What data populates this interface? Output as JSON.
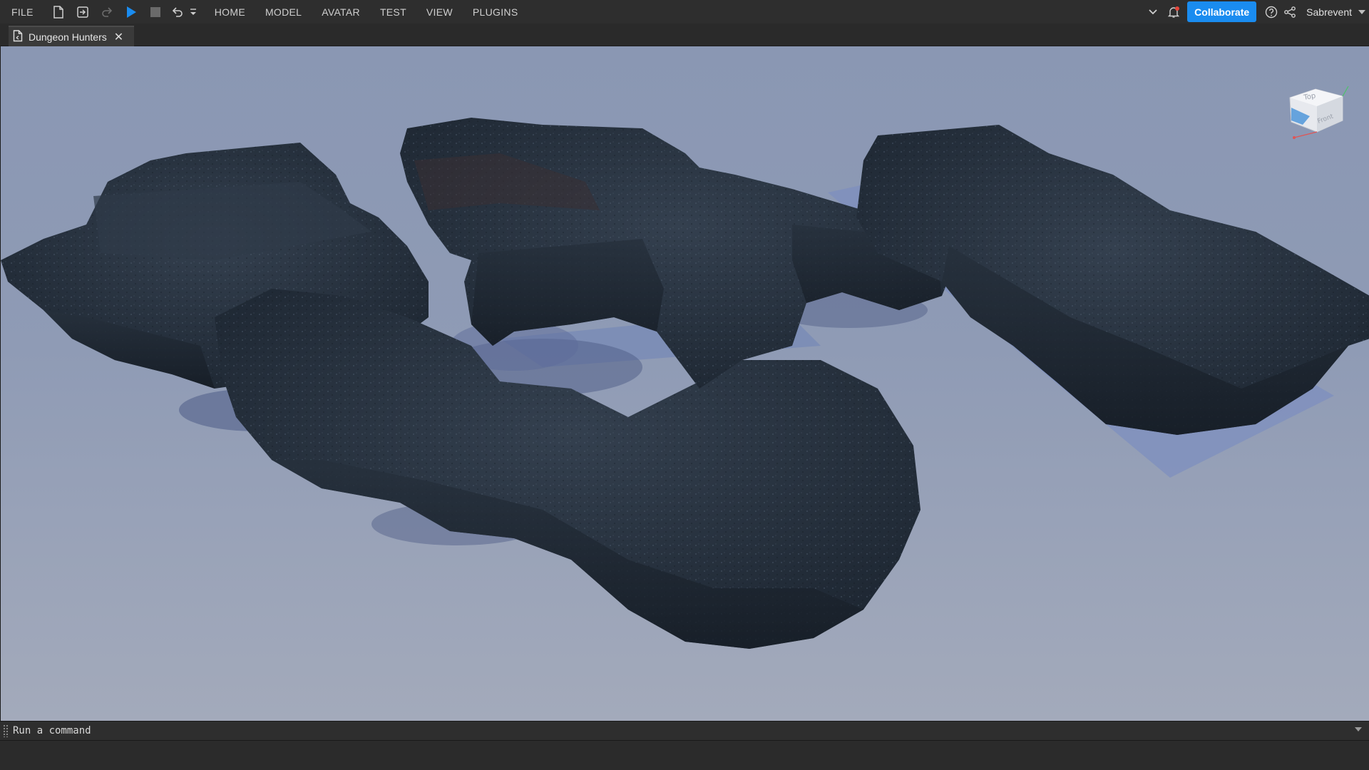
{
  "menubar": {
    "file_label": "FILE",
    "items": [
      {
        "label": "HOME"
      },
      {
        "label": "MODEL"
      },
      {
        "label": "AVATAR"
      },
      {
        "label": "TEST"
      },
      {
        "label": "VIEW"
      },
      {
        "label": "PLUGINS"
      }
    ],
    "toolbar_icons": [
      "new-file-icon",
      "publish-icon",
      "redo-icon",
      "play-icon",
      "stop-icon",
      "undo-icon",
      "more-icon"
    ]
  },
  "right_toolbar": {
    "collaborate_label": "Collaborate",
    "user_name": "Sabrevent",
    "icons": [
      "dropdown-chevron-icon",
      "notification-bell-icon",
      "help-icon",
      "share-icon",
      "user-chevron-icon"
    ]
  },
  "tabs": [
    {
      "label": "Dungeon Hunters",
      "icon": "document-icon"
    }
  ],
  "viewport": {
    "view_cube": {
      "top_label": "Top",
      "front_label": "Front"
    }
  },
  "command_bar": {
    "placeholder": "Run a command"
  },
  "colors": {
    "accent": "#1a8cf0",
    "chrome_dark": "#2e2e2e",
    "viewport_sky": "#8f9bb2",
    "rock": "#25303d"
  }
}
